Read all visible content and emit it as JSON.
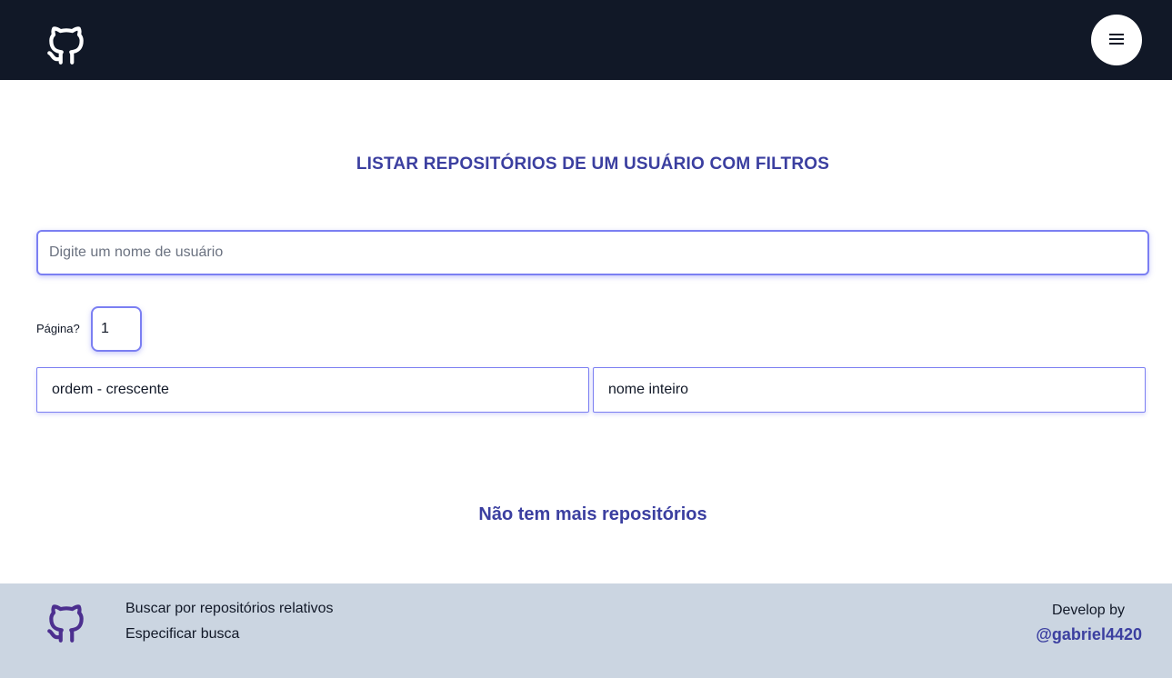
{
  "header": {
    "logo_icon": "github-icon",
    "menu_icon": "hamburger-icon",
    "bg_color": "#111827"
  },
  "main": {
    "title": "LISTAR REPOSITÓRIOS DE UM USUÁRIO COM FILTROS",
    "search": {
      "placeholder": "Digite um nome de usuário",
      "value": ""
    },
    "page": {
      "label": "Página?",
      "value": "1"
    },
    "order_select": {
      "selected": "ordem - crescente"
    },
    "name_select": {
      "selected": "nome inteiro"
    },
    "empty_message": "Não tem mais repositórios",
    "accent_color": "#3b3fa0"
  },
  "footer": {
    "logo_icon": "github-icon",
    "links": [
      "Buscar por repositórios relativos",
      "Especificar busca"
    ],
    "develop_label": "Develop by",
    "author": "@gabriel4420",
    "bg_color": "#cbd5e1"
  }
}
